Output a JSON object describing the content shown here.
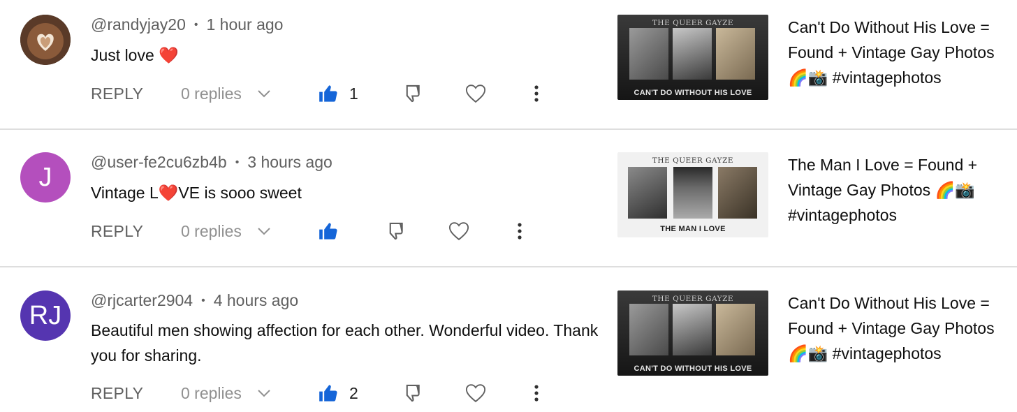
{
  "comments": [
    {
      "username": "@randyjay20",
      "time": "1 hour ago",
      "text": "Just love",
      "emoji": "❤️",
      "reply_label": "REPLY",
      "replies": "0 replies",
      "likes": "1",
      "avatar_type": "latte-photo",
      "video": {
        "thumb_header": "THE QUEER GAYZE",
        "thumb_caption": "CAN'T DO WITHOUT HIS LOVE",
        "title": "Can't Do Without His Love = Found + Vintage Gay Photos 🌈📸 #vintagephotos"
      }
    },
    {
      "username": "@user-fe2cu6zb4b",
      "time": "3 hours ago",
      "text_before": "Vintage L",
      "emoji": "❤️",
      "text_after": "VE is sooo sweet",
      "reply_label": "REPLY",
      "replies": "0 replies",
      "likes": "",
      "avatar_initials": "J",
      "avatar_color": "#b44fbd",
      "video": {
        "thumb_header": "THE QUEER GAYZE",
        "thumb_caption": "THE MAN I LOVE",
        "title": "The Man I Love = Found + Vintage Gay Photos 🌈📸 #vintagephotos"
      }
    },
    {
      "username": "@rjcarter2904",
      "time": "4 hours ago",
      "text": "Beautiful men showing affection for each other. Wonderful video. Thank you for sharing.",
      "reply_label": "REPLY",
      "replies": "0 replies",
      "likes": "2",
      "avatar_initials": "RJ",
      "avatar_color": "#5535b0",
      "video": {
        "thumb_header": "THE QUEER GAYZE",
        "thumb_caption": "CAN'T DO WITHOUT HIS LOVE",
        "title": "Can't Do Without His Love = Found + Vintage Gay Photos 🌈📸 #vintagephotos"
      }
    }
  ],
  "colors": {
    "like_blue": "#1565d8",
    "icon_gray": "#606060",
    "divider": "#dedede"
  }
}
